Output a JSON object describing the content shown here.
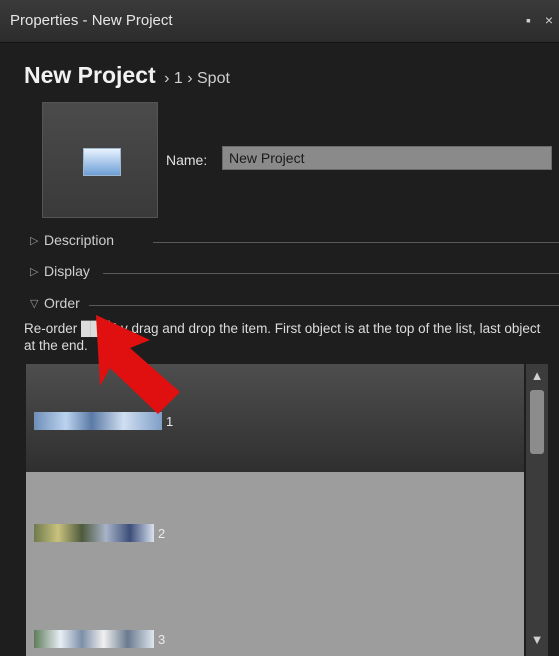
{
  "window": {
    "title": "Properties - New Project",
    "pin_icon": "pin-icon",
    "close_icon": "close-icon"
  },
  "breadcrumb": {
    "project": "New Project",
    "path": "› 1 › Spot"
  },
  "name_field": {
    "label": "Name:",
    "value": "New Project"
  },
  "sections": [
    {
      "label": "Description",
      "state": "collapsed"
    },
    {
      "label": "Display",
      "state": "collapsed"
    },
    {
      "label": "Order",
      "state": "expanded"
    }
  ],
  "order_hint": "Re-order ███ by drag and drop the item. First object is at the top of the list, last object at the end.",
  "order_list": {
    "items": [
      {
        "label": "1",
        "selected": true
      },
      {
        "label": "2",
        "selected": false
      },
      {
        "label": "3",
        "selected": false
      }
    ]
  },
  "annotation": {
    "color": "#e01010"
  }
}
